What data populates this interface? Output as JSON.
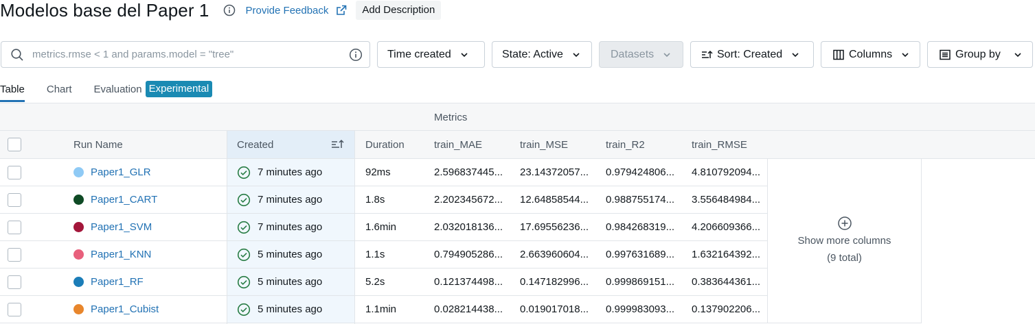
{
  "header": {
    "title": "Modelos base del Paper 1",
    "feedback_label": "Provide Feedback",
    "add_description_label": "Add Description"
  },
  "filters": {
    "search_placeholder": "metrics.rmse < 1 and params.model = \"tree\"",
    "time_created_label": "Time created",
    "state_label": "State: Active",
    "datasets_label": "Datasets",
    "sort_label": "Sort: Created",
    "columns_label": "Columns",
    "group_by_label": "Group by"
  },
  "tabs": {
    "table": "Table",
    "chart": "Chart",
    "evaluation": "Evaluation",
    "experimental_tag": "Experimental"
  },
  "table": {
    "group_header": "Metrics",
    "columns": {
      "run_name": "Run Name",
      "created": "Created",
      "duration": "Duration",
      "train_mae": "train_MAE",
      "train_mse": "train_MSE",
      "train_r2": "train_R2",
      "train_rmse": "train_RMSE"
    },
    "rows": [
      {
        "name": "Paper1_GLR",
        "color": "#8fcaf5",
        "created": "7 minutes ago",
        "duration": "92ms",
        "mae": "2.596837445...",
        "mse": "23.14372057...",
        "r2": "0.979424806...",
        "rmse": "4.810792094..."
      },
      {
        "name": "Paper1_CART",
        "color": "#0f4a25",
        "created": "7 minutes ago",
        "duration": "1.8s",
        "mae": "2.202345672...",
        "mse": "12.64858544...",
        "r2": "0.988755174...",
        "rmse": "3.556484984..."
      },
      {
        "name": "Paper1_SVM",
        "color": "#a3163a",
        "created": "7 minutes ago",
        "duration": "1.6min",
        "mae": "2.032018136...",
        "mse": "17.69556236...",
        "r2": "0.984268319...",
        "rmse": "4.206609366..."
      },
      {
        "name": "Paper1_KNN",
        "color": "#e8607c",
        "created": "5 minutes ago",
        "duration": "1.1s",
        "mae": "0.794905286...",
        "mse": "2.663960604...",
        "r2": "0.997631689...",
        "rmse": "1.632164392..."
      },
      {
        "name": "Paper1_RF",
        "color": "#1b7db8",
        "created": "5 minutes ago",
        "duration": "5.2s",
        "mae": "0.121374498...",
        "mse": "0.147182996...",
        "r2": "0.999869151...",
        "rmse": "0.383644361..."
      },
      {
        "name": "Paper1_Cubist",
        "color": "#e8862c",
        "created": "5 minutes ago",
        "duration": "1.1min",
        "mae": "0.028214438...",
        "mse": "0.019017018...",
        "r2": "0.999983093...",
        "rmse": "0.137902206..."
      }
    ],
    "show_more_label": "Show more columns",
    "show_more_count": "(9 total)"
  },
  "icons": {
    "info": "info-icon",
    "external_link": "external-link-icon",
    "search": "search-icon",
    "chevron": "chevron-down-icon",
    "sort": "sort-icon",
    "columns": "columns-icon",
    "group_by": "list-icon",
    "check_circle": "check-circle-icon",
    "plus_circle": "plus-circle-icon"
  },
  "colors": {
    "accent": "#2272b4",
    "success": "#277c43",
    "experimental_tag": "#1a8ab3"
  }
}
